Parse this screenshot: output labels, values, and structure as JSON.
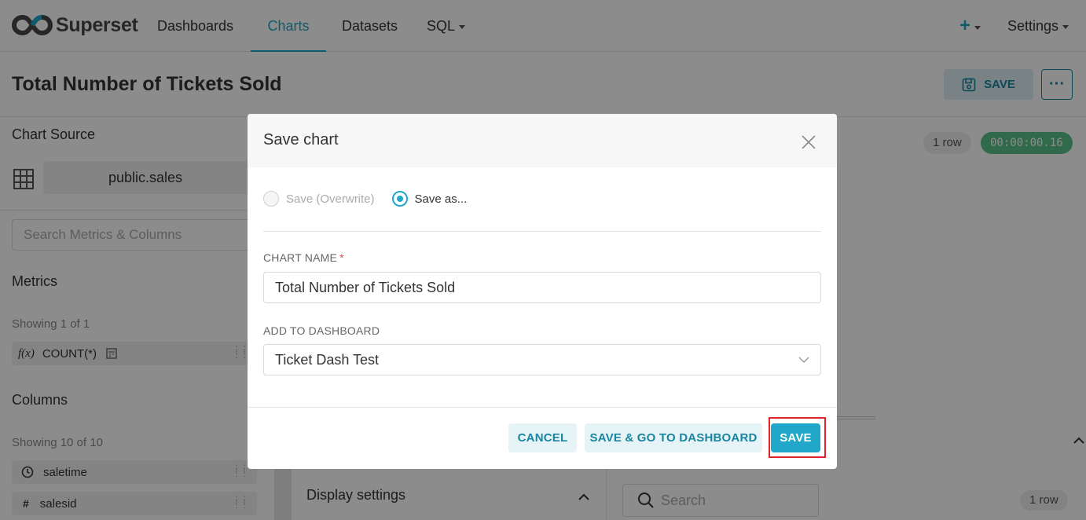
{
  "app": {
    "logo_text": "Superset",
    "nav": {
      "dashboards": "Dashboards",
      "charts": "Charts",
      "datasets": "Datasets",
      "sql": "SQL",
      "plus": "+",
      "settings": "Settings"
    }
  },
  "header": {
    "chart_title": "Total Number of Tickets Sold",
    "save_label": "SAVE",
    "more_label": "···"
  },
  "left_panel": {
    "chart_source_label": "Chart Source",
    "dataset": "public.sales",
    "search_placeholder": "Search Metrics & Columns",
    "metrics_label": "Metrics",
    "metrics_count": "Showing 1 of 1",
    "metric_fx": "f(x)",
    "metric_name": "COUNT(*)",
    "columns_label": "Columns",
    "columns_count": "Showing 10 of 10",
    "columns": [
      {
        "type_icon": "clock-icon",
        "name": "saletime"
      },
      {
        "type_icon": "hash-icon",
        "type_glyph": "#",
        "name": "salesid"
      }
    ]
  },
  "control_panel": {
    "display_settings": "Display settings"
  },
  "results": {
    "row_count": "1 row",
    "query_time": "00:00:00.16",
    "search_placeholder": "Search",
    "bottom_row_count": "1 row"
  },
  "modal": {
    "title": "Save chart",
    "radio_overwrite": "Save (Overwrite)",
    "radio_save_as": "Save as...",
    "selected_option": "save_as",
    "chart_name_label": "CHART NAME",
    "required_mark": "*",
    "chart_name_value": "Total Number of Tickets Sold",
    "dashboard_label": "ADD TO DASHBOARD",
    "dashboard_value": "Ticket Dash Test",
    "cancel_label": "CANCEL",
    "save_go_label": "SAVE & GO TO DASHBOARD",
    "save_label": "SAVE"
  },
  "colors": {
    "accent": "#20a7c9",
    "accent_dark": "#1a85a0",
    "success": "#5ac189",
    "highlight": "#e0242c"
  }
}
